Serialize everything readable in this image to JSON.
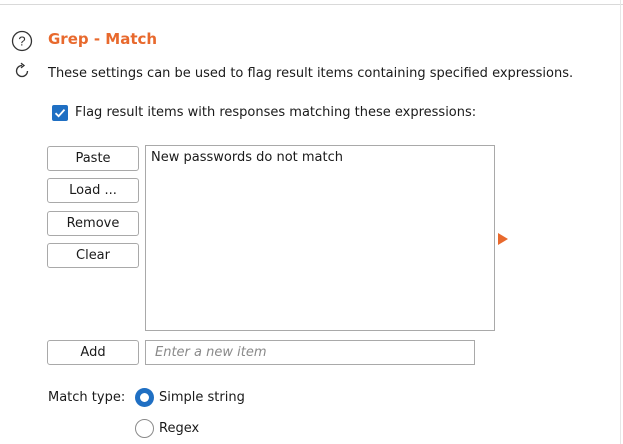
{
  "section": {
    "title": "Grep - Match",
    "description": "These settings can be used to flag result items containing specified expressions."
  },
  "flag_option": {
    "label": "Flag result items with responses matching these expressions:",
    "checked": true
  },
  "list_buttons": {
    "paste": "Paste",
    "load": "Load ...",
    "remove": "Remove",
    "clear": "Clear"
  },
  "expressions": [
    "New passwords do not match"
  ],
  "add": {
    "button_label": "Add",
    "placeholder": "Enter a new item"
  },
  "match_type": {
    "label": "Match type:",
    "options": [
      {
        "label": "Simple string",
        "selected": true
      },
      {
        "label": "Regex",
        "selected": false
      }
    ]
  },
  "colors": {
    "accent": "#e8692d",
    "control_blue": "#1f6fc3"
  },
  "icons": {
    "help": "help-icon",
    "refresh": "refresh-icon",
    "checkmark": "checkmark-icon",
    "expand": "expand-arrow-icon"
  }
}
